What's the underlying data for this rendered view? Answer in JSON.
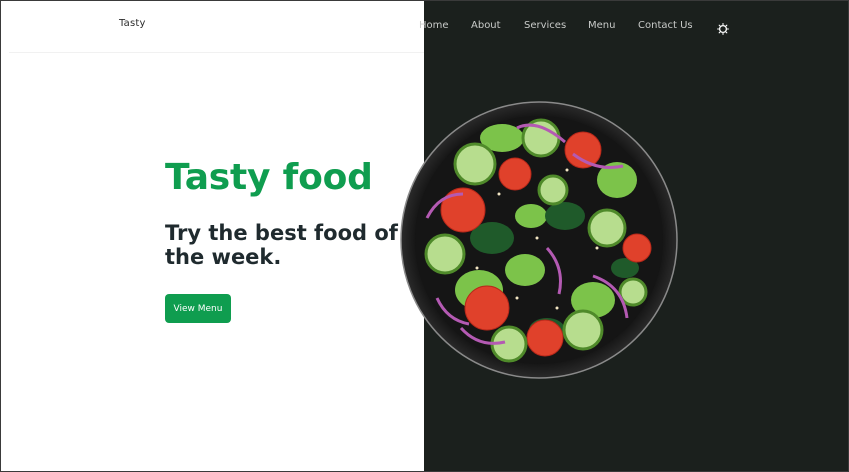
{
  "header": {
    "logo": "Tasty",
    "nav": {
      "home": "Home",
      "about": "About",
      "services": "Services",
      "menu": "Menu",
      "contact": "Contact Us"
    },
    "theme_toggle_icon": "sun-icon"
  },
  "hero": {
    "title": "Tasty food",
    "subtitle": "Try the best food of the week.",
    "cta_label": "View Menu",
    "image_icon": "salad-bowl-image"
  },
  "colors": {
    "accent": "#0f9d4f",
    "dark_panel": "#1b201d",
    "heading_text": "#1f2a2e",
    "nav_text": "#c9cbc9"
  }
}
